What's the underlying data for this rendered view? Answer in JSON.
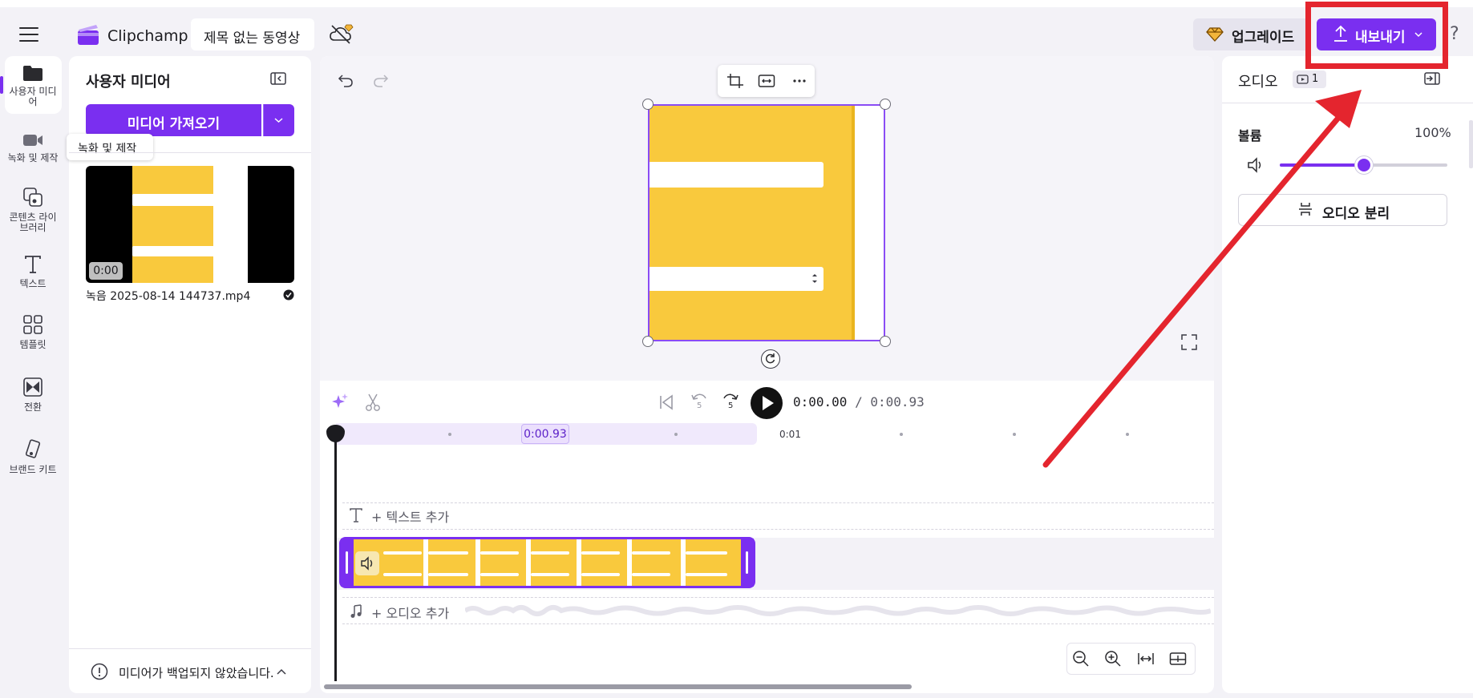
{
  "app": {
    "brand": "Clipchamp",
    "project_title": "제목 없는 동영상",
    "upgrade_label": "업그레이드",
    "export_label": "내보내기",
    "help_label": "?",
    "accent_color": "#7a2ff0",
    "annotation_color": "#e4252e"
  },
  "rail": {
    "items": [
      {
        "label": "사용자 미디어",
        "icon": "folder-icon",
        "active": true
      },
      {
        "label": "녹화 및 제작",
        "icon": "camera-icon"
      },
      {
        "label": "콘텐츠 라이브러리",
        "icon": "library-icon"
      },
      {
        "label": "텍스트",
        "icon": "text-icon"
      },
      {
        "label": "템플릿",
        "icon": "template-icon"
      },
      {
        "label": "전환",
        "icon": "transition-icon"
      },
      {
        "label": "브랜드 키트",
        "icon": "brand-kit-icon"
      }
    ],
    "tooltip": "녹화 및 제작"
  },
  "media": {
    "title": "사용자 미디어",
    "import_label": "미디어 가져오기",
    "items": [
      {
        "name": "녹음 2025-08-14 144737.mp4",
        "duration": "0:00"
      }
    ],
    "backup_note": "미디어가 백업되지 않았습니다."
  },
  "timeline": {
    "current_time": "0:00.00",
    "separator": " / ",
    "total_time": "0:00.93",
    "marker_tag": "0:00.93",
    "ruler_label": "0:01",
    "skip_back_label": "5",
    "skip_fwd_label": "5",
    "add_text_label": "+ 텍스트 추가",
    "add_audio_label": "+ 오디오 추가"
  },
  "properties": {
    "title": "오디오",
    "badge_count": "1",
    "volume_label": "볼륨",
    "volume_value": "100%",
    "volume_level": 0.5,
    "split_audio_label": "오디오 분리"
  }
}
